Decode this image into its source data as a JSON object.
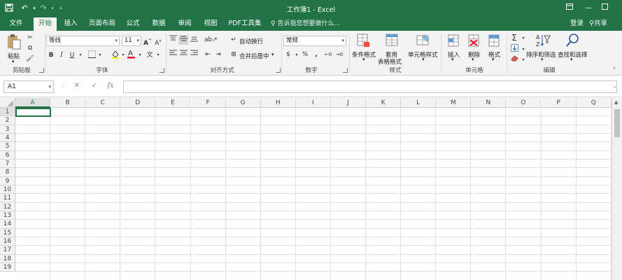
{
  "window": {
    "title": "工作簿1 - Excel"
  },
  "tabs": [
    {
      "label": "文件"
    },
    {
      "label": "开始"
    },
    {
      "label": "插入"
    },
    {
      "label": "页面布局"
    },
    {
      "label": "公式"
    },
    {
      "label": "数据"
    },
    {
      "label": "审阅"
    },
    {
      "label": "视图"
    },
    {
      "label": "PDF工具集"
    }
  ],
  "tell_me": "♀ 告诉我您想要做什么...",
  "account": {
    "signin": "登录",
    "share": "共享"
  },
  "ribbon": {
    "clipboard": {
      "paste": "粘贴",
      "label": "剪贴板"
    },
    "font": {
      "name": "等线",
      "size": "11",
      "label": "字体"
    },
    "alignment": {
      "wrap": "自动换行",
      "merge": "合并后居中",
      "label": "对齐方式"
    },
    "number": {
      "format": "常规",
      "percent": "%",
      "comma": ",",
      "label": "数字"
    },
    "styles": {
      "conditional": "条件格式",
      "table1": "套用",
      "table2": "表格格式",
      "cell_styles": "单元格样式",
      "label": "样式"
    },
    "cells": {
      "insert": "插入",
      "delete": "删除",
      "format": "格式",
      "label": "单元格"
    },
    "editing": {
      "sum": "Σ",
      "sort": "排序和筛选",
      "find": "查找和选择",
      "label": "编辑"
    }
  },
  "formula_bar": {
    "name_box": "A1",
    "fx": "fx",
    "value": ""
  },
  "columns": [
    "A",
    "B",
    "C",
    "D",
    "E",
    "F",
    "G",
    "H",
    "I",
    "J",
    "K",
    "L",
    "M",
    "N",
    "O",
    "P",
    "Q"
  ],
  "rows": [
    "1",
    "2",
    "3",
    "4",
    "5",
    "6",
    "7",
    "8",
    "9",
    "10",
    "11",
    "12",
    "13",
    "14",
    "15",
    "16",
    "17",
    "18",
    "19"
  ],
  "colors": {
    "accent": "#217346",
    "ribbon": "#f3f3f3"
  }
}
